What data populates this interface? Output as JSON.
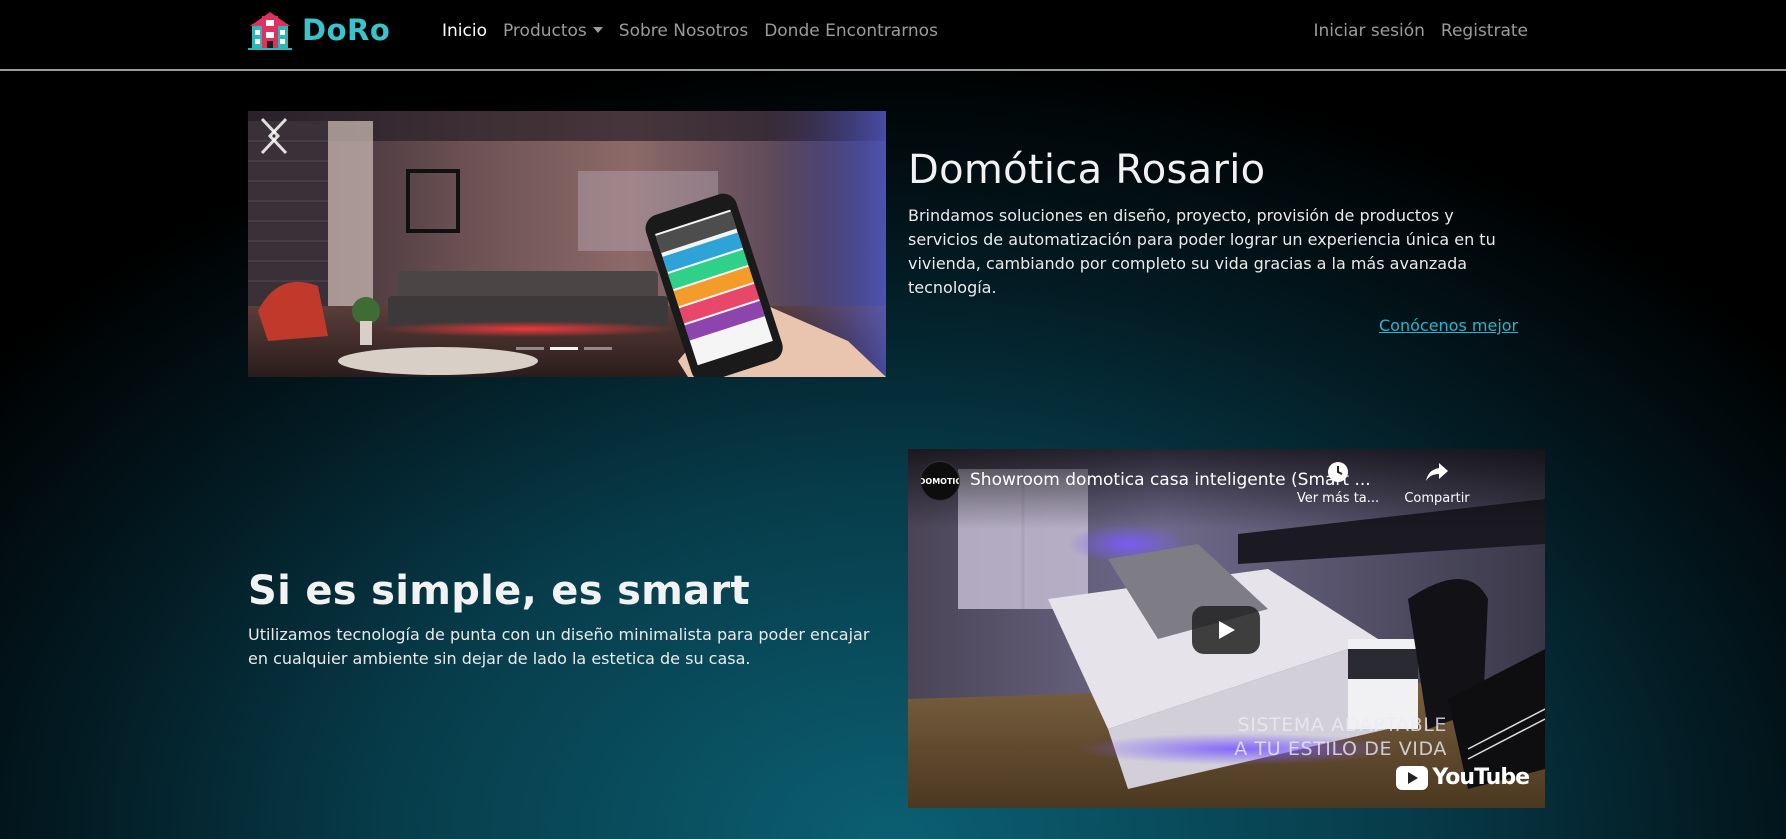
{
  "brand": {
    "name": "DoRo",
    "color": "#39c4cc"
  },
  "nav": {
    "left": [
      "Inicio",
      "Productos",
      "Sobre Nosotros",
      "Donde Encontrarnos"
    ],
    "active": "Inicio",
    "right": [
      "Iniciar sesión",
      "Registrate"
    ]
  },
  "carousel": {
    "slide_count": 3,
    "active_slide": 2
  },
  "hero": {
    "title": "Domótica Rosario",
    "description": "Brindamos soluciones en diseño, proyecto, provisión de productos y servicios de automatización para poder lograr un experiencia única en tu vivienda, cambiando por completo su vida gracias a la más avanzada tecnología.",
    "link_label": "Conócenos mejor",
    "link_color": "#23b7d3"
  },
  "section2": {
    "title": "Si es simple, es smart",
    "description": "Utilizamos tecnología de punta con un diseño minimalista para poder encajar en cualquier ambiente sin dejar de lado la estetica de su casa."
  },
  "video": {
    "channel_avatar": "DOMOTIC",
    "title": "Showroom domotica casa inteligente (Smart ...",
    "watch_later": "Ver más ta...",
    "share": "Compartir",
    "overlay_line1": "SISTEMA ADAPTABLE",
    "overlay_line2": "A TU ESTILO DE VIDA",
    "platform": "YouTube"
  }
}
